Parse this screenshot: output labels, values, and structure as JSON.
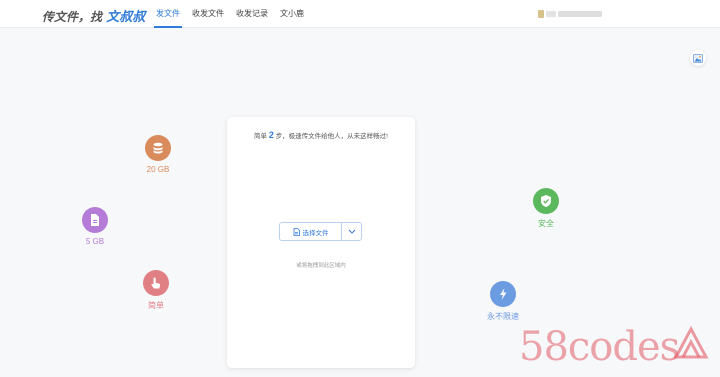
{
  "header": {
    "logo_prefix": "传文件，找",
    "logo_accent": "文叔叔",
    "nav": [
      {
        "label": "发文件",
        "active": true
      },
      {
        "label": "收发文件",
        "active": false
      },
      {
        "label": "收发记录",
        "active": false
      },
      {
        "label": "文小鹿",
        "active": false
      }
    ]
  },
  "features": {
    "storage": {
      "label": "20 GB",
      "icon": "database-icon",
      "color": "#d98b5b"
    },
    "file_size": {
      "label": "5 GB",
      "icon": "file-icon",
      "color": "#b47cd6"
    },
    "simple": {
      "label": "简单",
      "icon": "hand-pointer-icon",
      "color": "#e07f84"
    },
    "safe": {
      "label": "安全",
      "icon": "shield-check-icon",
      "color": "#5cb85c"
    },
    "no_limit": {
      "label": "永不限速",
      "icon": "lightning-icon",
      "color": "#6b9be0"
    }
  },
  "card": {
    "headline_before": "简单",
    "headline_num": "2",
    "headline_after": "步，极速传文件给他人，从未这样畅过!",
    "choose_label": "选择文件",
    "drop_hint": "或将拖拽到此区域内"
  },
  "watermark": {
    "text": "58codes"
  },
  "colors": {
    "accent": "#2f7bd9",
    "background": "#f7f8fa"
  }
}
